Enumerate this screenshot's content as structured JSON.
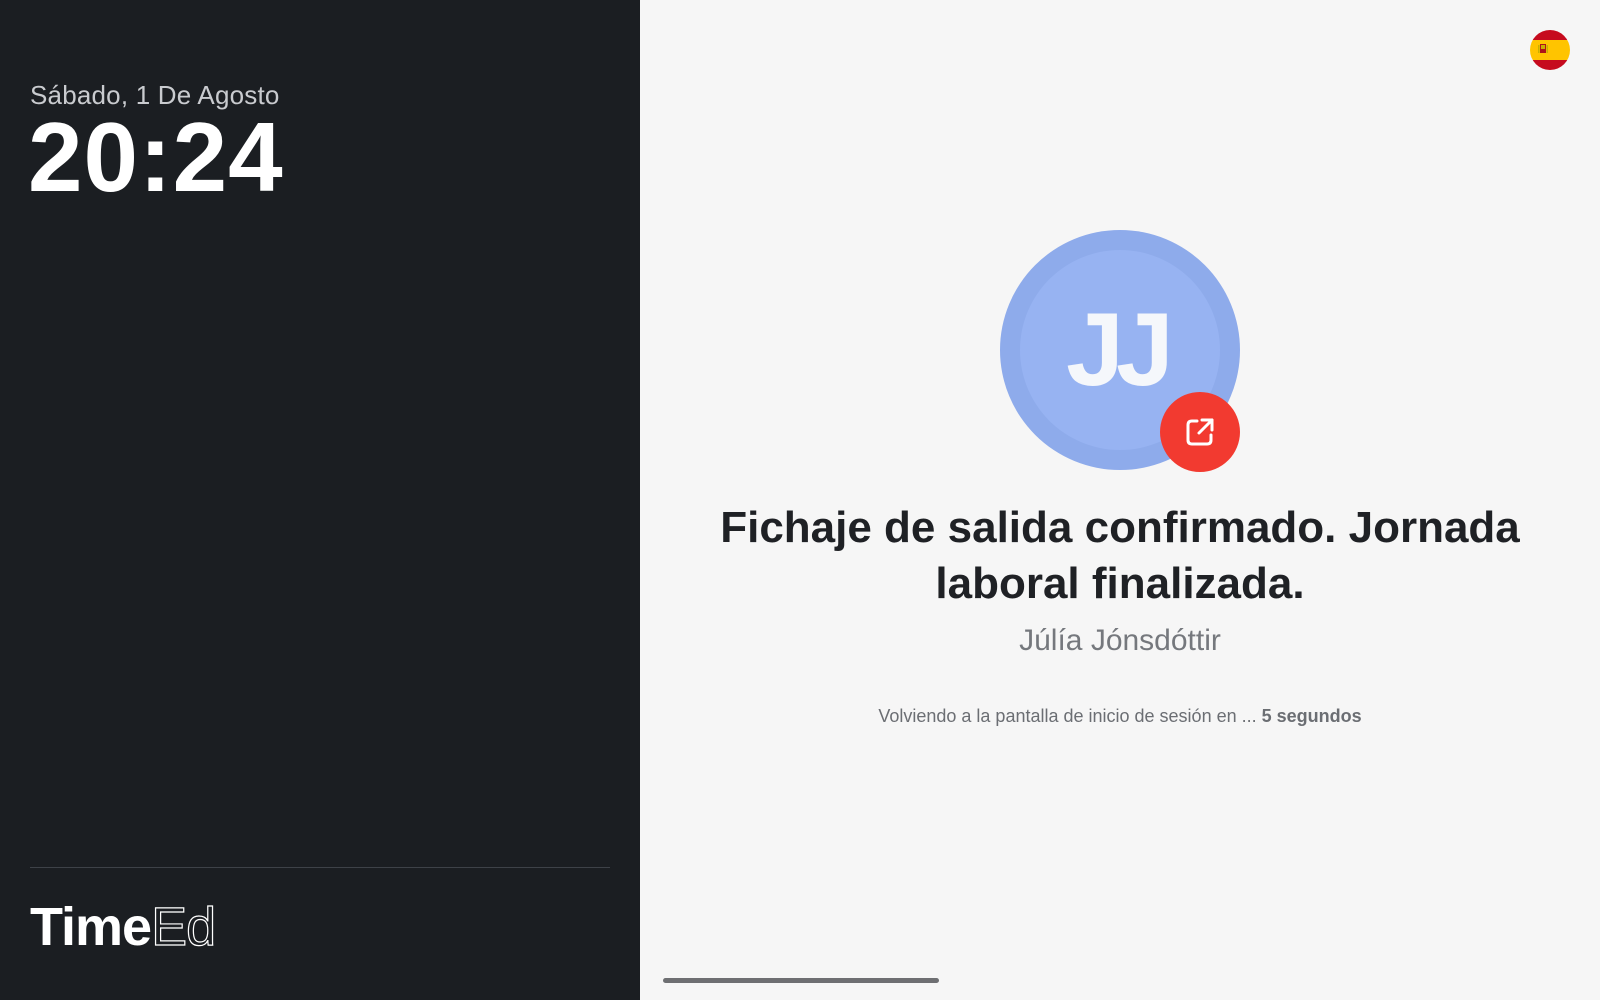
{
  "left_panel": {
    "date": "Sábado, 1 De Agosto",
    "time": "20:24",
    "brand": {
      "bold": "Time",
      "light": "Ed"
    }
  },
  "right_panel": {
    "language_flag": {
      "icon": "spain-flag-icon",
      "colors": {
        "red": "#c60b1e",
        "yellow": "#ffc400"
      }
    },
    "avatar": {
      "initials": "JJ",
      "color": "#8eabeb"
    },
    "status_badge": {
      "icon": "clock-out-arrow-icon",
      "color": "#f23a30"
    },
    "message": "Fichaje de salida confirmado. Jornada laboral finalizada.",
    "user_name": "Júlía Jónsdóttir",
    "redirect": {
      "text": "Volviendo a la pantalla de inicio de sesión en ...",
      "countdown": "5 segundos"
    }
  }
}
